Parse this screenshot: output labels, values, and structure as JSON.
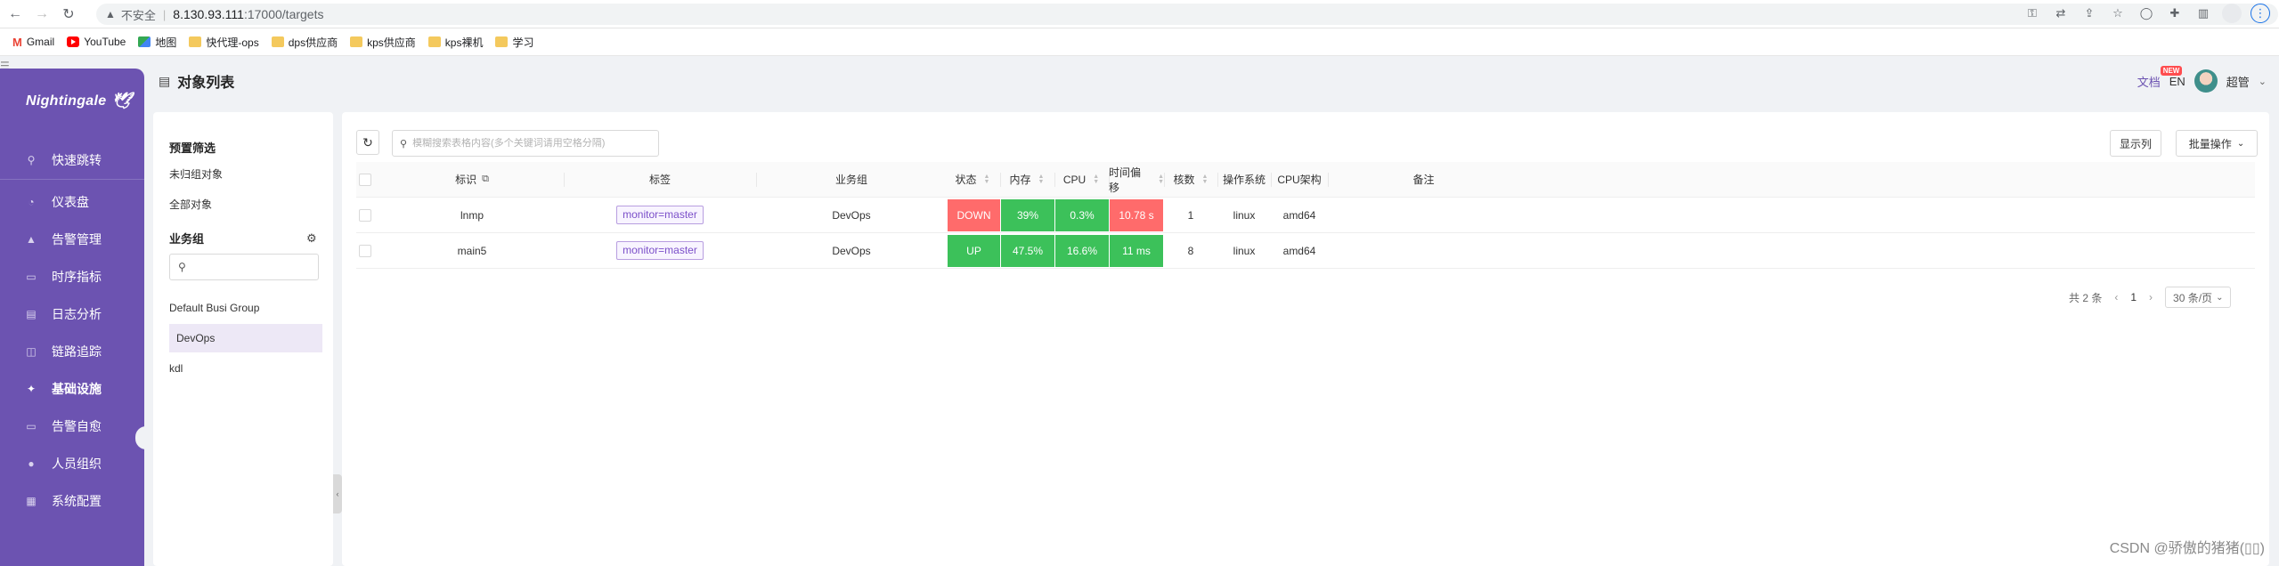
{
  "browser": {
    "insecure_label": "不安全",
    "url_host": "8.130.93.111",
    "url_path": ":17000/targets",
    "bookmarks": [
      {
        "label": "Gmail",
        "icon": "gmail-icon"
      },
      {
        "label": "YouTube",
        "icon": "youtube-icon"
      },
      {
        "label": "地图",
        "icon": "maps-icon"
      },
      {
        "label": "快代理-ops",
        "icon": "folder-icon"
      },
      {
        "label": "dps供应商",
        "icon": "folder-icon"
      },
      {
        "label": "kps供应商",
        "icon": "folder-icon"
      },
      {
        "label": "kps裸机",
        "icon": "folder-icon"
      },
      {
        "label": "学习",
        "icon": "folder-icon"
      }
    ]
  },
  "sidebar": {
    "logo": "Nightingale",
    "items": [
      {
        "label": "快速跳转",
        "icon": "search-icon"
      },
      {
        "label": "仪表盘",
        "icon": "dashboard-icon"
      },
      {
        "label": "告警管理",
        "icon": "alarm-icon"
      },
      {
        "label": "时序指标",
        "icon": "chart-icon"
      },
      {
        "label": "日志分析",
        "icon": "log-icon"
      },
      {
        "label": "链路追踪",
        "icon": "trace-icon"
      },
      {
        "label": "基础设施",
        "icon": "infra-icon"
      },
      {
        "label": "告警自愈",
        "icon": "heal-icon"
      },
      {
        "label": "人员组织",
        "icon": "user-icon"
      },
      {
        "label": "系统配置",
        "icon": "settings-icon"
      }
    ]
  },
  "header": {
    "title": "对象列表",
    "docs": "文档",
    "new_badge": "NEW",
    "lang": "EN",
    "user": "超管"
  },
  "filter_panel": {
    "preset_title": "预置筛选",
    "preset_items": [
      "未归组对象",
      "全部对象"
    ],
    "group_title": "业务组",
    "groups": [
      "Default Busi Group",
      "DevOps",
      "kdl"
    ],
    "selected_group": "DevOps"
  },
  "toolbar": {
    "search_placeholder": "模糊搜索表格内容(多个关键词请用空格分隔)",
    "columns_btn": "显示列",
    "batch_btn": "批量操作"
  },
  "table": {
    "headers": {
      "ident": "标识",
      "tags": "标签",
      "group": "业务组",
      "status": "状态",
      "mem": "内存",
      "cpu": "CPU",
      "offset": "时间偏移",
      "cores": "核数",
      "os": "操作系统",
      "arch": "CPU架构",
      "note": "备注"
    },
    "rows": [
      {
        "ident": "lnmp",
        "tag": "monitor=master",
        "group": "DevOps",
        "status": "DOWN",
        "mem": "39%",
        "cpu": "0.3%",
        "offset": "10.78 s",
        "cores": "1",
        "os": "linux",
        "arch": "amd64",
        "note": ""
      },
      {
        "ident": "main5",
        "tag": "monitor=master",
        "group": "DevOps",
        "status": "UP",
        "mem": "47.5%",
        "cpu": "16.6%",
        "offset": "11 ms",
        "cores": "8",
        "os": "linux",
        "arch": "amd64",
        "note": ""
      }
    ]
  },
  "pagination": {
    "total": "共 2 条",
    "page": "1",
    "page_size": "30 条/页"
  },
  "colors": {
    "sidebar": "#6c53b1",
    "bad": "#ff6b6b",
    "good": "#3cc15a",
    "tag": "#7b4fc9"
  },
  "watermark": "CSDN @骄傲的猪猪(▯▯)"
}
